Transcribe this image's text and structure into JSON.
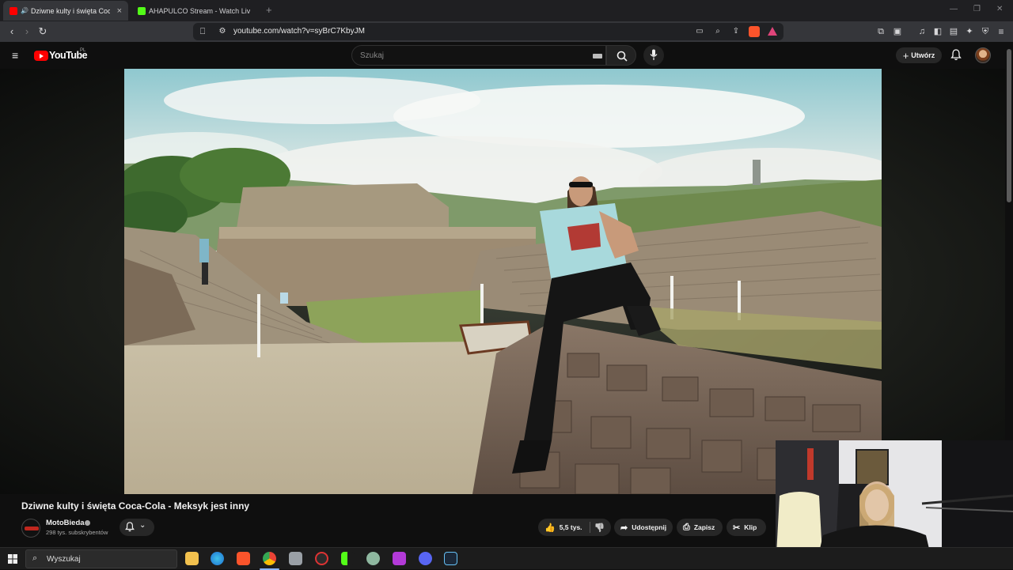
{
  "browser": {
    "tabs": [
      {
        "title": "Dziwne kulty i święta Coca-Co",
        "active": true
      },
      {
        "title": "AHAPULCO Stream - Watch Live on K",
        "active": false
      }
    ],
    "new_tab_symbol": "+",
    "url": "youtube.com/watch?v=syBrC7KbyJM"
  },
  "youtube": {
    "logo_text": "YouTube",
    "region": "PL",
    "search_placeholder": "Szukaj",
    "create_label": "Utwórz"
  },
  "video": {
    "title": "Dziwne kulty i święta Coca-Cola - Meksyk jest inny",
    "channel_name": "MotoBieda",
    "subscribers": "298 tys. subskrybentów",
    "actions": {
      "likes": "5,5 tys.",
      "share": "Udostępnij",
      "save": "Zapisz",
      "clip": "Klip"
    }
  },
  "taskbar": {
    "search_label": "Wyszukaj"
  },
  "colors": {
    "youtube_red": "#ff0000",
    "kick_green": "#53fc18",
    "page_bg": "#0f0f0f"
  }
}
